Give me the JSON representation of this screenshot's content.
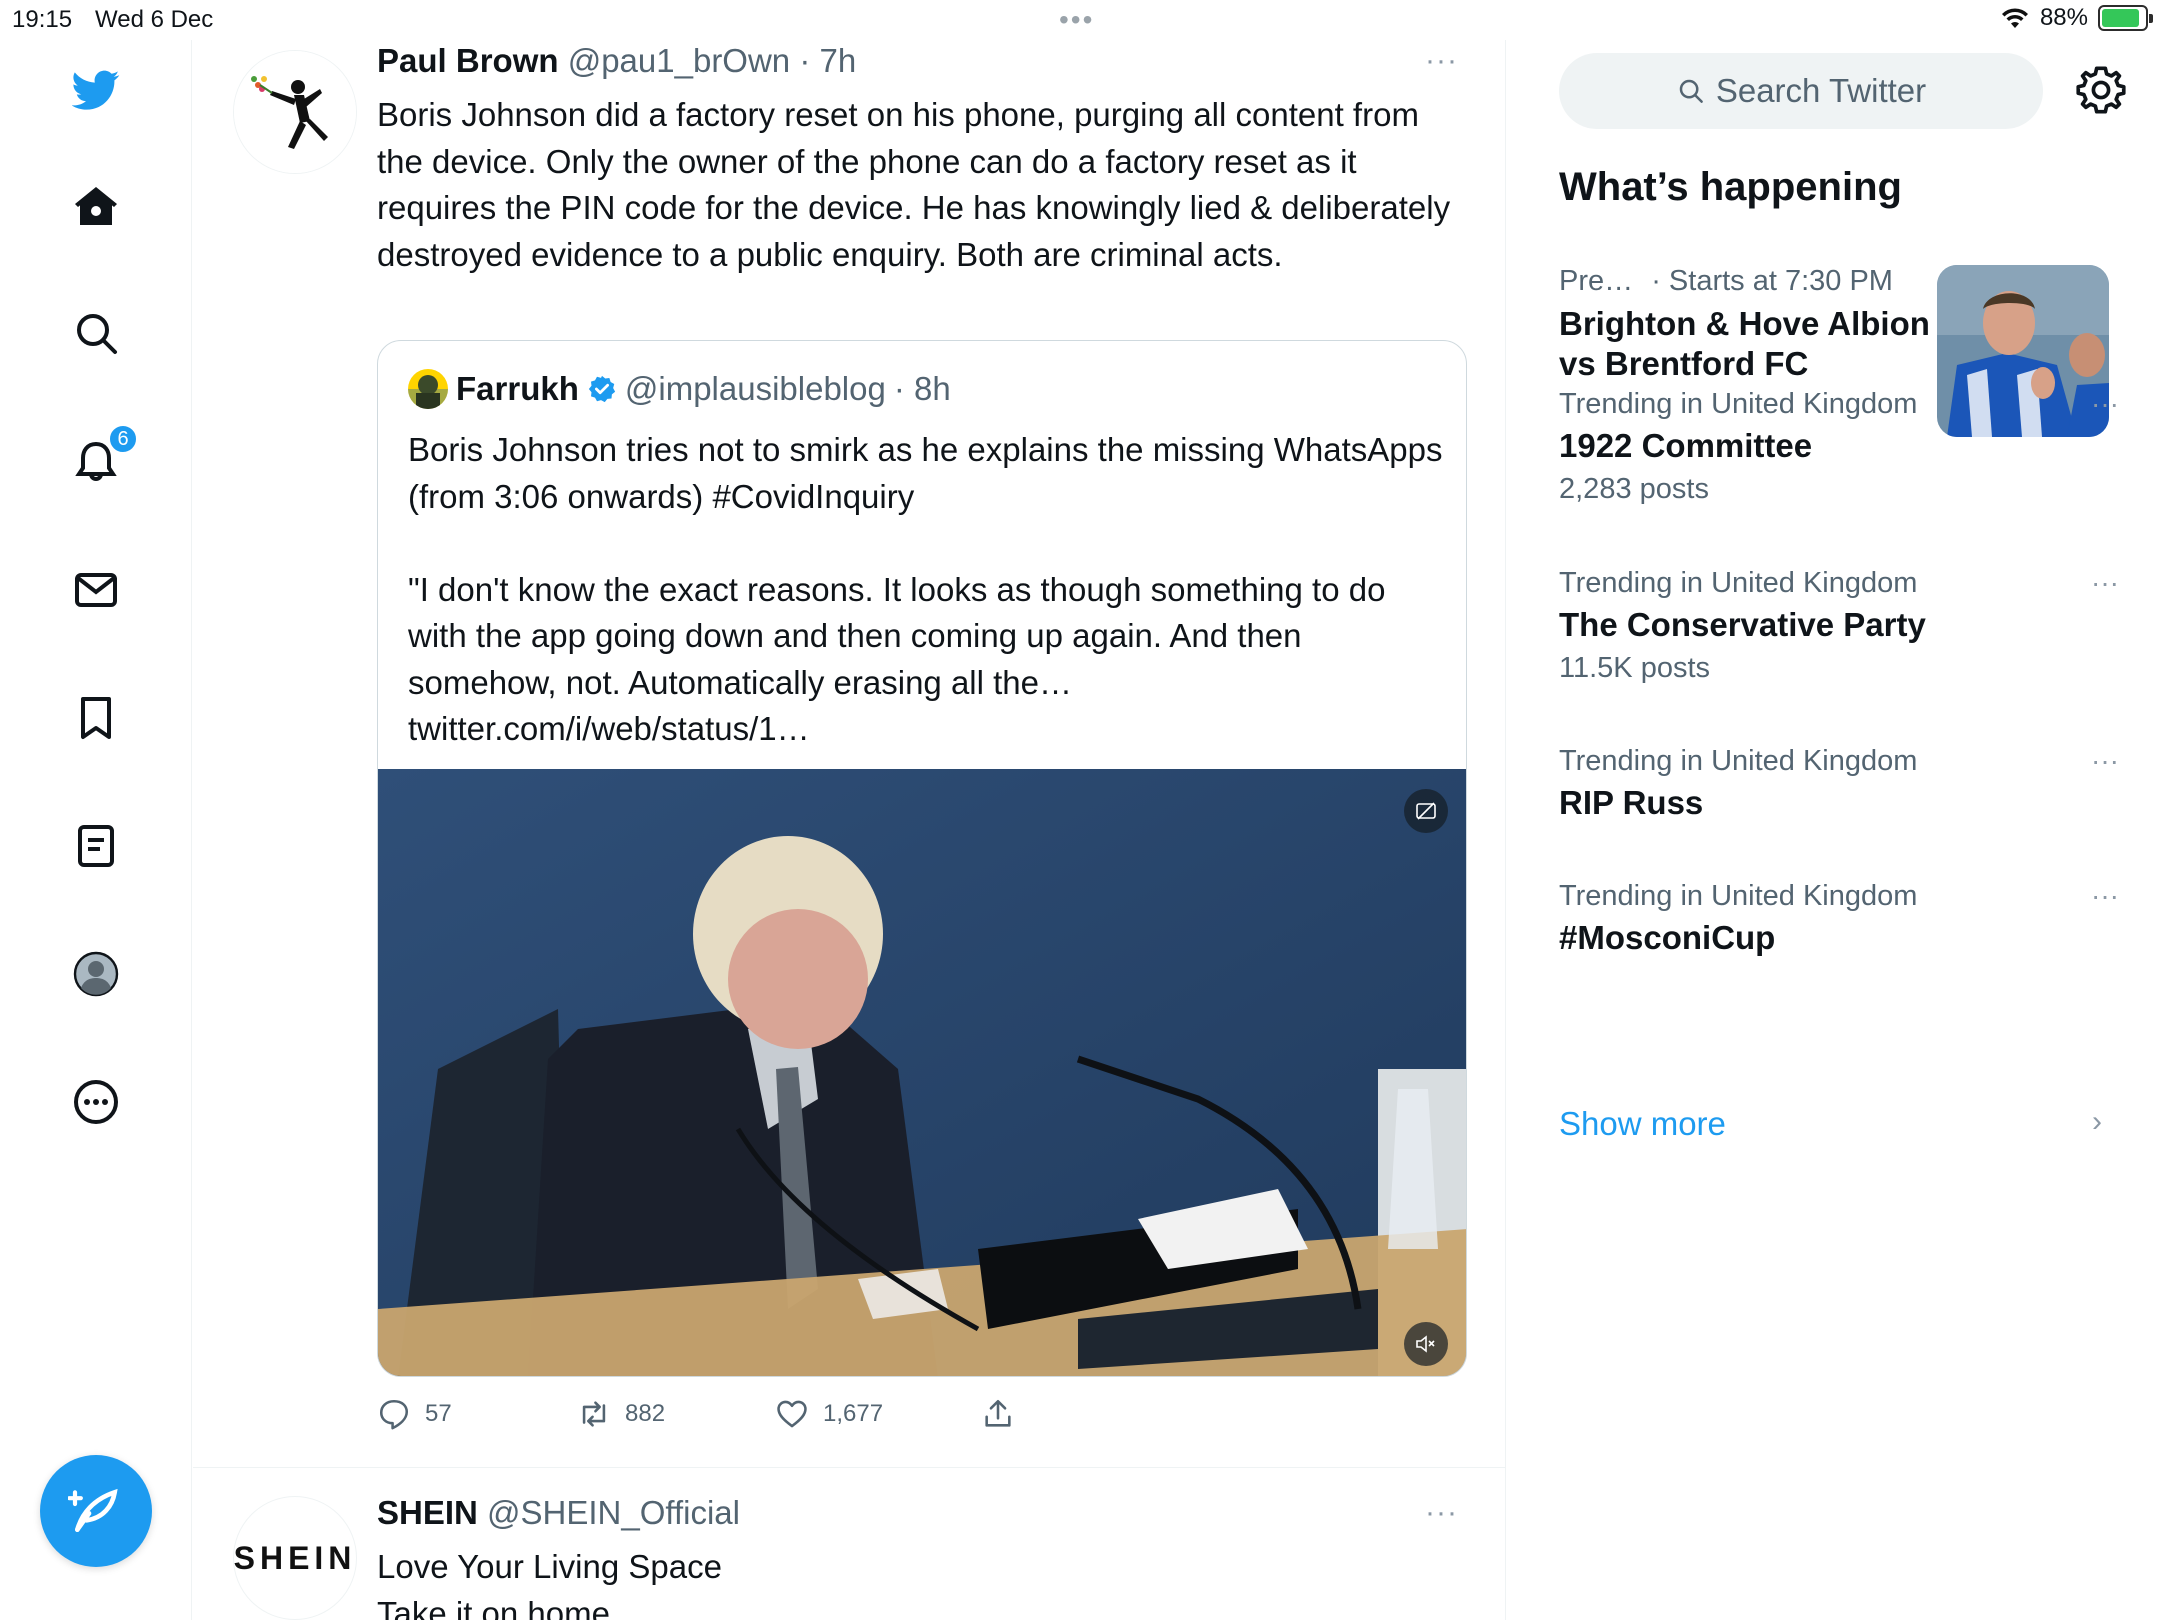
{
  "status_bar": {
    "time": "19:15",
    "date": "Wed 6 Dec",
    "battery": "88%",
    "battery_level": 0.88,
    "dots": "•••"
  },
  "nav": {
    "notifications_badge": "6",
    "items": [
      "twitter-logo",
      "home",
      "explore",
      "notifications",
      "messages",
      "bookmarks",
      "lists",
      "profile",
      "more"
    ]
  },
  "tweets": [
    {
      "name": "Paul Brown",
      "handle": "@pau1_brOwn",
      "time": "· 7h",
      "more": "···",
      "text": "Boris Johnson did a factory reset on his phone, purging all content from the device. Only the owner of the phone can do a factory reset as it requires the PIN code for the device. He has knowingly lied & deliberately destroyed evidence to a public enquiry. Both are criminal acts.",
      "quote": {
        "name": "Farrukh",
        "handle": "@implausibleblog",
        "time": "· 8h",
        "text": "Boris Johnson tries not to smirk as he explains the missing WhatsApps (from 3:06 onwards) #CovidInquiry\n\n\"I don't know the exact reasons. It looks as though something to do with the app going down and then coming up again. And then somehow, not. Automatically erasing all the… twitter.com/i/web/status/1…"
      },
      "replies": "57",
      "retweets": "882",
      "likes": "1,677"
    },
    {
      "name": "SHEIN",
      "handle": "@SHEIN_Official",
      "more": "···",
      "avatar_text": "SHEIN",
      "text": "Love Your Living Space\nTake it on home"
    }
  ],
  "sidebar": {
    "search_placeholder": "Search Twitter",
    "whats_happening": "What’s happening",
    "trends": [
      {
        "meta": "Pre…",
        "meta2": "· Starts at 7:30 PM",
        "title": "Brighton & Hove Albion vs Brentford FC"
      },
      {
        "meta": "Trending in United Kingdom",
        "title": "1922 Committee",
        "posts": "2,283 posts",
        "more": "···"
      },
      {
        "meta": "Trending in United Kingdom",
        "title": "The Conservative Party",
        "posts": "11.5K posts",
        "more": "···"
      },
      {
        "meta": "Trending in United Kingdom",
        "title": "RIP Russ",
        "more": "···"
      },
      {
        "meta": "Trending in United Kingdom",
        "title": "#MosconiCup",
        "more": "···"
      }
    ],
    "show_more": "Show more",
    "chevron": "›"
  },
  "colors": {
    "accent": "#1d9bf0",
    "text": "#0f1419",
    "secondary": "#536471",
    "battery": "#34c759"
  }
}
